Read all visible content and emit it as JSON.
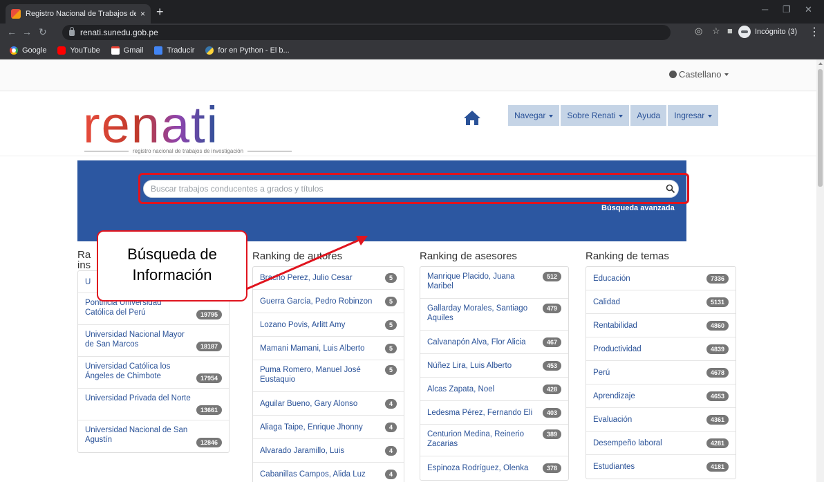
{
  "browser": {
    "tab_title": "Registro Nacional de Trabajos de",
    "tab_close": "×",
    "new_tab": "+",
    "url": "renati.sunedu.gob.pe",
    "incognito_label": "Incógnito (3)",
    "bookmarks": [
      {
        "label": "Google",
        "icon": "google-icon"
      },
      {
        "label": "YouTube",
        "icon": "youtube-icon"
      },
      {
        "label": "Gmail",
        "icon": "gmail-icon"
      },
      {
        "label": "Traducir",
        "icon": "translate-icon"
      },
      {
        "label": "for en Python - El b...",
        "icon": "python-icon"
      }
    ]
  },
  "header": {
    "language": "Castellano",
    "logo_text": "renati",
    "logo_subtitle": "registro nacional de trabajos de investigación",
    "nav": [
      "Navegar",
      "Sobre Renati",
      "Ayuda",
      "Ingresar"
    ]
  },
  "search": {
    "placeholder": "Buscar trabajos conducentes a grados y títulos",
    "advanced": "Búsqueda avanzada"
  },
  "annotation": {
    "line1": "Búsqueda de",
    "line2": "Información"
  },
  "rankings": {
    "instituciones": {
      "title_partial_1": "Ra",
      "title_partial_2": "ins",
      "items": [
        {
          "label": "U",
          "count": ""
        },
        {
          "label": "Pontificia Universidad Católica del Perú",
          "count": "19795"
        },
        {
          "label": "Universidad Nacional Mayor de San Marcos",
          "count": "18187"
        },
        {
          "label": "Universidad Católica los Ángeles de Chimbote",
          "count": "17954"
        },
        {
          "label": "Universidad Privada del Norte",
          "count": "13661"
        },
        {
          "label": "Universidad Nacional de San Agustín",
          "count": "12846"
        }
      ]
    },
    "autores": {
      "title": "Ranking de autores",
      "items": [
        {
          "label": "Bracho Perez, Julio Cesar",
          "count": "5"
        },
        {
          "label": "Guerra García, Pedro Robinzon",
          "count": "5"
        },
        {
          "label": "Lozano Povis, Arlitt Amy",
          "count": "5"
        },
        {
          "label": "Mamani Mamani, Luis Alberto",
          "count": "5"
        },
        {
          "label": "Puma Romero, Manuel José Eustaquio",
          "count": "5"
        },
        {
          "label": "Aguilar Bueno, Gary Alonso",
          "count": "4"
        },
        {
          "label": "Aliaga Taipe, Enrique Jhonny",
          "count": "4"
        },
        {
          "label": "Alvarado Jaramillo, Luis",
          "count": "4"
        },
        {
          "label": "Cabanillas Campos, Alida Luz",
          "count": "4"
        }
      ]
    },
    "asesores": {
      "title": "Ranking de asesores",
      "items": [
        {
          "label": "Manrique Placido, Juana Maribel",
          "count": "512"
        },
        {
          "label": "Gallarday Morales, Santiago Aquiles",
          "count": "479"
        },
        {
          "label": "Calvanapón Alva, Flor Alicia",
          "count": "467"
        },
        {
          "label": "Núñez Lira, Luis Alberto",
          "count": "453"
        },
        {
          "label": "Alcas Zapata, Noel",
          "count": "428"
        },
        {
          "label": "Ledesma Pérez, Fernando Eli",
          "count": "403"
        },
        {
          "label": "Centurion Medina, Reinerio Zacarias",
          "count": "389"
        },
        {
          "label": "Espinoza Rodríguez, Olenka",
          "count": "378"
        }
      ]
    },
    "temas": {
      "title": "Ranking de temas",
      "items": [
        {
          "label": "Educación",
          "count": "7336"
        },
        {
          "label": "Calidad",
          "count": "5131"
        },
        {
          "label": "Rentabilidad",
          "count": "4860"
        },
        {
          "label": "Productividad",
          "count": "4839"
        },
        {
          "label": "Perú",
          "count": "4678"
        },
        {
          "label": "Aprendizaje",
          "count": "4653"
        },
        {
          "label": "Evaluación",
          "count": "4361"
        },
        {
          "label": "Desempeño laboral",
          "count": "4281"
        },
        {
          "label": "Estudiantes",
          "count": "4181"
        }
      ]
    }
  },
  "colors": {
    "hero": "#2c57a1",
    "link": "#2a5298",
    "nav_bg": "#c5d4e6",
    "annotation": "#e0141e"
  }
}
